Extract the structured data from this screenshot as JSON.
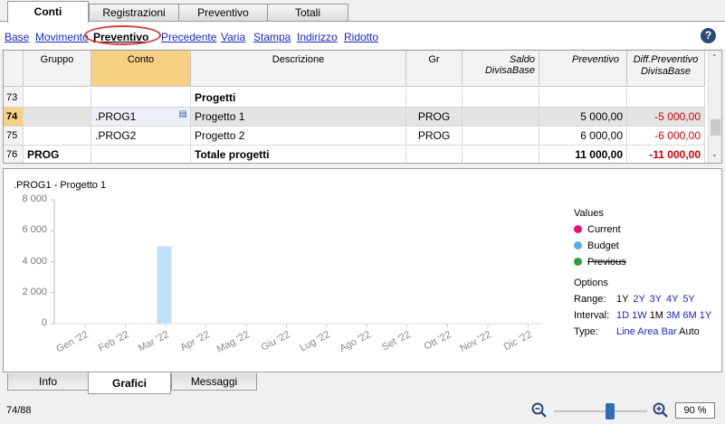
{
  "top_tabs": [
    {
      "label": "Conti",
      "active": true
    },
    {
      "label": "Registrazioni",
      "active": false
    },
    {
      "label": "Preventivo",
      "active": false
    },
    {
      "label": "Totali",
      "active": false
    }
  ],
  "views": [
    {
      "label": "Base",
      "active": false
    },
    {
      "label": "Movimento",
      "active": false
    },
    {
      "label": "Preventivo",
      "active": true
    },
    {
      "label": "Precedente",
      "active": false
    },
    {
      "label": "Varia",
      "active": false
    },
    {
      "label": "Stampa",
      "active": false
    },
    {
      "label": "Indirizzo",
      "active": false
    },
    {
      "label": "Ridotto",
      "active": false
    }
  ],
  "help_icon": "?",
  "grid": {
    "columns": [
      "Gruppo",
      "Conto",
      "Descrizione",
      "Gr",
      "Saldo DivisaBase",
      "Preventivo",
      "Diff.Preventivo DivisaBase"
    ],
    "rows": [
      {
        "num": "73",
        "gruppo": "",
        "conto": "",
        "descrizione": "Progetti",
        "gr": "",
        "saldo": "",
        "preventivo": "",
        "diff": "",
        "bold": true
      },
      {
        "num": "74",
        "gruppo": "",
        "conto": ".PROG1",
        "descrizione": "Progetto 1",
        "gr": "PROG",
        "saldo": "",
        "preventivo": "5 000,00",
        "diff": "-5 000,00",
        "bold": false,
        "selected": true
      },
      {
        "num": "75",
        "gruppo": "",
        "conto": ".PROG2",
        "descrizione": "Progetto 2",
        "gr": "PROG",
        "saldo": "",
        "preventivo": "6 000,00",
        "diff": "-6 000,00",
        "bold": false
      },
      {
        "num": "76",
        "gruppo": "PROG",
        "conto": "",
        "descrizione": "Totale progetti",
        "gr": "",
        "saldo": "",
        "preventivo": "11 000,00",
        "diff": "-11 000,00",
        "bold": true
      }
    ]
  },
  "chart_data": {
    "type": "bar",
    "title": ".PROG1 - Progetto 1",
    "categories": [
      "Gen '22",
      "Feb '22",
      "Mar '22",
      "Apr '22",
      "Mag '22",
      "Giu '22",
      "Lug '22",
      "Ago '22",
      "Set '22",
      "Ott '22",
      "Nov '22",
      "Dic '22"
    ],
    "series": [
      {
        "name": "Budget",
        "color": "#bfe0f7",
        "values": [
          0,
          5000,
          0,
          0,
          0,
          0,
          0,
          0,
          0,
          0,
          0,
          0
        ]
      }
    ],
    "yticks": [
      "8 000",
      "6 000",
      "4 000",
      "2 000",
      "0"
    ],
    "ylim": [
      0,
      8000
    ],
    "grid": true
  },
  "legend": {
    "title": "Values",
    "items": [
      {
        "label": "Current",
        "color": "#e8117f",
        "struck": false
      },
      {
        "label": "Budget",
        "color": "#5aaee8",
        "struck": false
      },
      {
        "label": "Previous",
        "color": "#2e9e3c",
        "struck": true
      }
    ]
  },
  "options": {
    "title": "Options",
    "range_label": "Range:",
    "range": [
      {
        "label": "1Y",
        "current": true
      },
      {
        "label": "2Y"
      },
      {
        "label": "3Y"
      },
      {
        "label": "4Y"
      },
      {
        "label": "5Y"
      }
    ],
    "interval_label": "Interval:",
    "interval": [
      {
        "label": "1D"
      },
      {
        "label": "1W"
      },
      {
        "label": "1M",
        "current": true
      },
      {
        "label": "3M"
      },
      {
        "label": "6M"
      },
      {
        "label": "1Y"
      }
    ],
    "type_label": "Type:",
    "type": [
      {
        "label": "Line"
      },
      {
        "label": "Area"
      },
      {
        "label": "Bar"
      },
      {
        "label": "Auto",
        "current": true
      }
    ]
  },
  "bottom_tabs": [
    {
      "label": "Info",
      "active": false
    },
    {
      "label": "Grafici",
      "active": true
    },
    {
      "label": "Messaggi",
      "active": false
    }
  ],
  "status": {
    "row_position": "74/88",
    "zoom_value": "90 %",
    "zoom_level": 0.6
  }
}
